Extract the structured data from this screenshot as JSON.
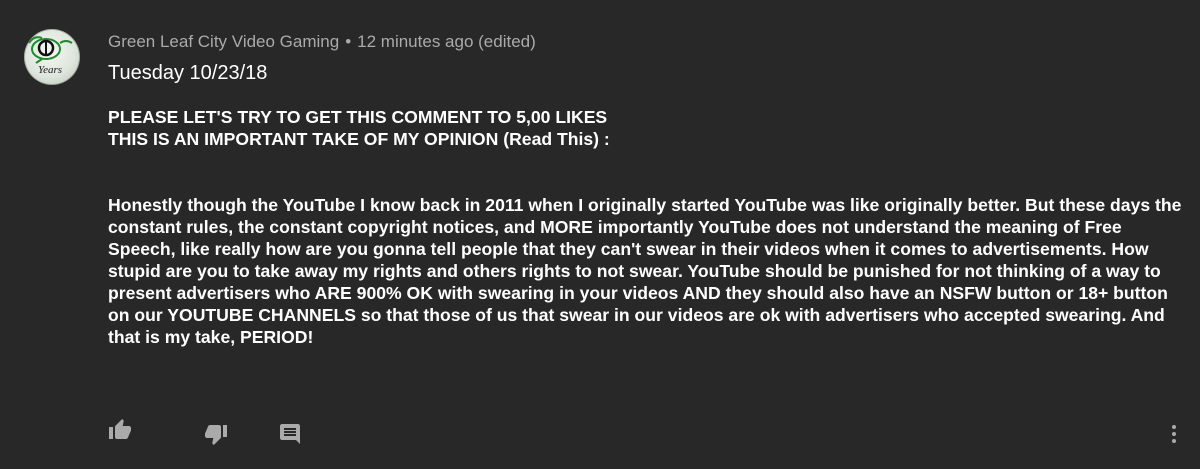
{
  "comment": {
    "author": "Green Leaf City Video Gaming",
    "separator": "•",
    "time": "12 minutes ago (edited)",
    "avatar_text": "Years",
    "date_line": "Tuesday 10/23/18",
    "headline_1": "PLEASE LET'S TRY TO GET THIS COMMENT TO 5,00 LIKES",
    "headline_2": "THIS IS AN IMPORTANT TAKE OF MY OPINION (Read This) :",
    "body": "Honestly though the YouTube I know back in 2011 when I originally started YouTube was like originally better. But these days the constant rules, the constant copyright notices, and MORE importantly YouTube does not understand the meaning of Free Speech, like really how are you gonna tell people that they can't swear in their videos when it comes to advertisements. How stupid are you to take away my rights and others rights to not swear. YouTube should be punished for not thinking of a way to present advertisers who ARE 900% OK with swearing in your videos AND they should also have an NSFW button or 18+ button on our YOUTUBE CHANNELS so that those of us that swear in our videos are ok with advertisers who accepted swearing. And that is my take, PERIOD!"
  },
  "actions": {
    "like_icon": "thumb-up-icon",
    "dislike_icon": "thumb-down-icon",
    "reply_icon": "comment-icon",
    "more_icon": "more-vert-icon"
  },
  "colors": {
    "background": "#282828",
    "text": "#ffffff",
    "meta": "#aaaaaa",
    "icon": "#aaaaaa",
    "logo_green": "#1f8a2e"
  }
}
